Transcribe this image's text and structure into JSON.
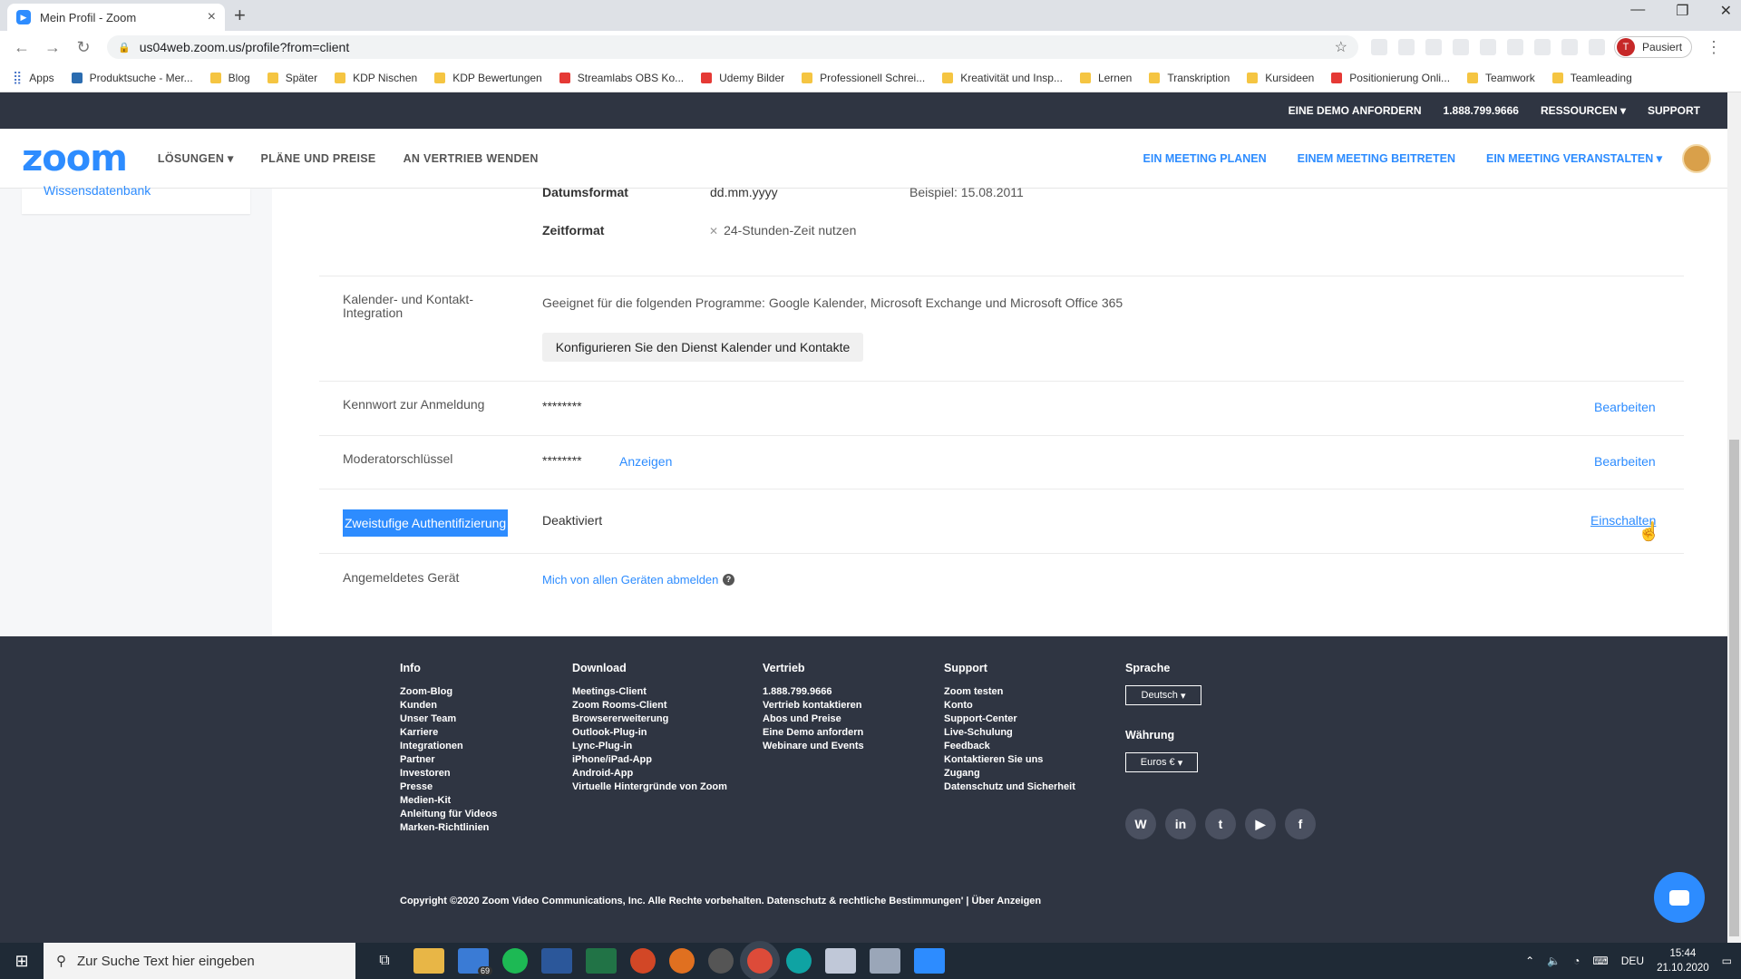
{
  "browser": {
    "tab_title": "Mein Profil - Zoom",
    "url": "us04web.zoom.us/profile?from=client",
    "profile_label": "Pausiert",
    "profile_initial": "T",
    "bookmarks": [
      "Apps",
      "Produktsuche - Mer...",
      "Blog",
      "Später",
      "KDP Nischen",
      "KDP Bewertungen",
      "Streamlabs OBS Ko...",
      "Udemy Bilder",
      "Professionell Schrei...",
      "Kreativität und Insp...",
      "Lernen",
      "Transkription",
      "Kursideen",
      "Positionierung Onli...",
      "Teamwork",
      "Teamleading"
    ]
  },
  "zoom_top": {
    "demo": "EINE DEMO ANFORDERN",
    "phone": "1.888.799.9666",
    "resources": "RESSOURCEN",
    "support": "SUPPORT"
  },
  "zoom_nav": {
    "logo": "zoom",
    "solutions": "LÖSUNGEN",
    "plans": "PLÄNE UND PREISE",
    "sales": "AN VERTRIEB WENDEN",
    "schedule": "EIN MEETING PLANEN",
    "join": "EINEM MEETING BEITRETEN",
    "host": "EIN MEETING VERANSTALTEN"
  },
  "sidebar": {
    "item": "Wissensdatenbank"
  },
  "profile": {
    "date_format_label": "Datumsformat",
    "date_format_value": "dd.mm.yyyy",
    "date_format_example": "Beispiel: 15.08.2011",
    "time_format_label": "Zeitformat",
    "time_format_value": "24-Stunden-Zeit nutzen",
    "calendar_label": "Kalender- und Kontakt-Integration",
    "calendar_desc": "Geeignet für die folgenden Programme: Google Kalender, Microsoft Exchange und Microsoft Office 365",
    "calendar_button": "Konfigurieren Sie den Dienst Kalender und Kontakte",
    "password_label": "Kennwort zur Anmeldung",
    "password_value": "********",
    "password_edit": "Bearbeiten",
    "host_key_label": "Moderatorschlüssel",
    "host_key_value": "********",
    "host_key_show": "Anzeigen",
    "host_key_edit": "Bearbeiten",
    "twofa_label": "Zweistufige Authentifizierung",
    "twofa_value": "Deaktiviert",
    "twofa_action": "Einschalten",
    "device_label": "Angemeldetes Gerät",
    "device_action": "Mich von allen Geräten abmelden"
  },
  "footer": {
    "info_title": "Info",
    "info_items": [
      "Zoom-Blog",
      "Kunden",
      "Unser Team",
      "Karriere",
      "Integrationen",
      "Partner",
      "Investoren",
      "Presse",
      "Medien-Kit",
      "Anleitung für Videos",
      "Marken-Richtlinien"
    ],
    "download_title": "Download",
    "download_items": [
      "Meetings-Client",
      "Zoom Rooms-Client",
      "Browsererweiterung",
      "Outlook-Plug-in",
      "Lync-Plug-in",
      "iPhone/iPad-App",
      "Android-App",
      "Virtuelle Hintergründe von Zoom"
    ],
    "sales_title": "Vertrieb",
    "sales_items": [
      "1.888.799.9666",
      "Vertrieb kontaktieren",
      "Abos und Preise",
      "Eine Demo anfordern",
      "Webinare und Events"
    ],
    "support_title": "Support",
    "support_items": [
      "Zoom testen",
      "Konto",
      "Support-Center",
      "Live-Schulung",
      "Feedback",
      "Kontaktieren Sie uns",
      "Zugang",
      "Datenschutz und Sicherheit"
    ],
    "language_title": "Sprache",
    "language_value": "Deutsch",
    "currency_title": "Währung",
    "currency_value": "Euros €",
    "copyright": "Copyright ©2020 Zoom Video Communications, Inc. Alle Rechte vorbehalten.  Datenschutz & rechtliche Bestimmungen'  |  Über Anzeigen"
  },
  "taskbar": {
    "search_placeholder": "Zur Suche Text hier eingeben",
    "mail_badge": "69",
    "lang": "DEU",
    "time": "15:44",
    "date": "21.10.2020"
  },
  "colors": {
    "zoom_blue": "#2d8cff",
    "dark_header": "#2f3542"
  }
}
